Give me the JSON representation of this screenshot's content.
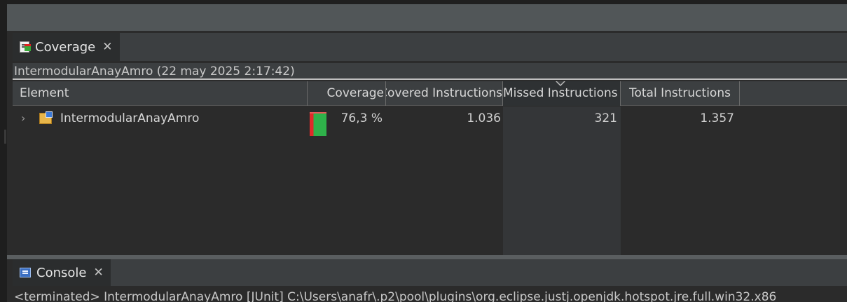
{
  "coverage_view": {
    "tab": {
      "label": "Coverage",
      "icon": "coverage-icon",
      "close": "✕"
    },
    "session_label": "IntermodularAnayAmro (22 may 2025 2:17:42)",
    "columns": {
      "element": "Element",
      "coverage": "Coverage",
      "covered_instructions": "Covered Instructions",
      "missed_instructions": "Missed Instructions",
      "total_instructions": "Total Instructions"
    },
    "rows": [
      {
        "element": "IntermodularAnayAmro",
        "icon": "java-project-icon",
        "coverage": "76,3 %",
        "coverage_fraction": 0.763,
        "covered_instructions": "1.036",
        "missed_instructions": "321",
        "total_instructions": "1.357"
      }
    ],
    "sorted_column": "missed_instructions",
    "colors": {
      "covered": "#2fb24a",
      "missed": "#e02a2a"
    }
  },
  "console_view": {
    "tab": {
      "label": "Console",
      "icon": "console-icon",
      "close": "✕"
    },
    "status": "<terminated> IntermodularAnayAmro [JUnit] C:\\Users\\anafr\\.p2\\pool\\plugins\\org.eclipse.justj.openjdk.hotspot.jre.full.win32.x86"
  }
}
